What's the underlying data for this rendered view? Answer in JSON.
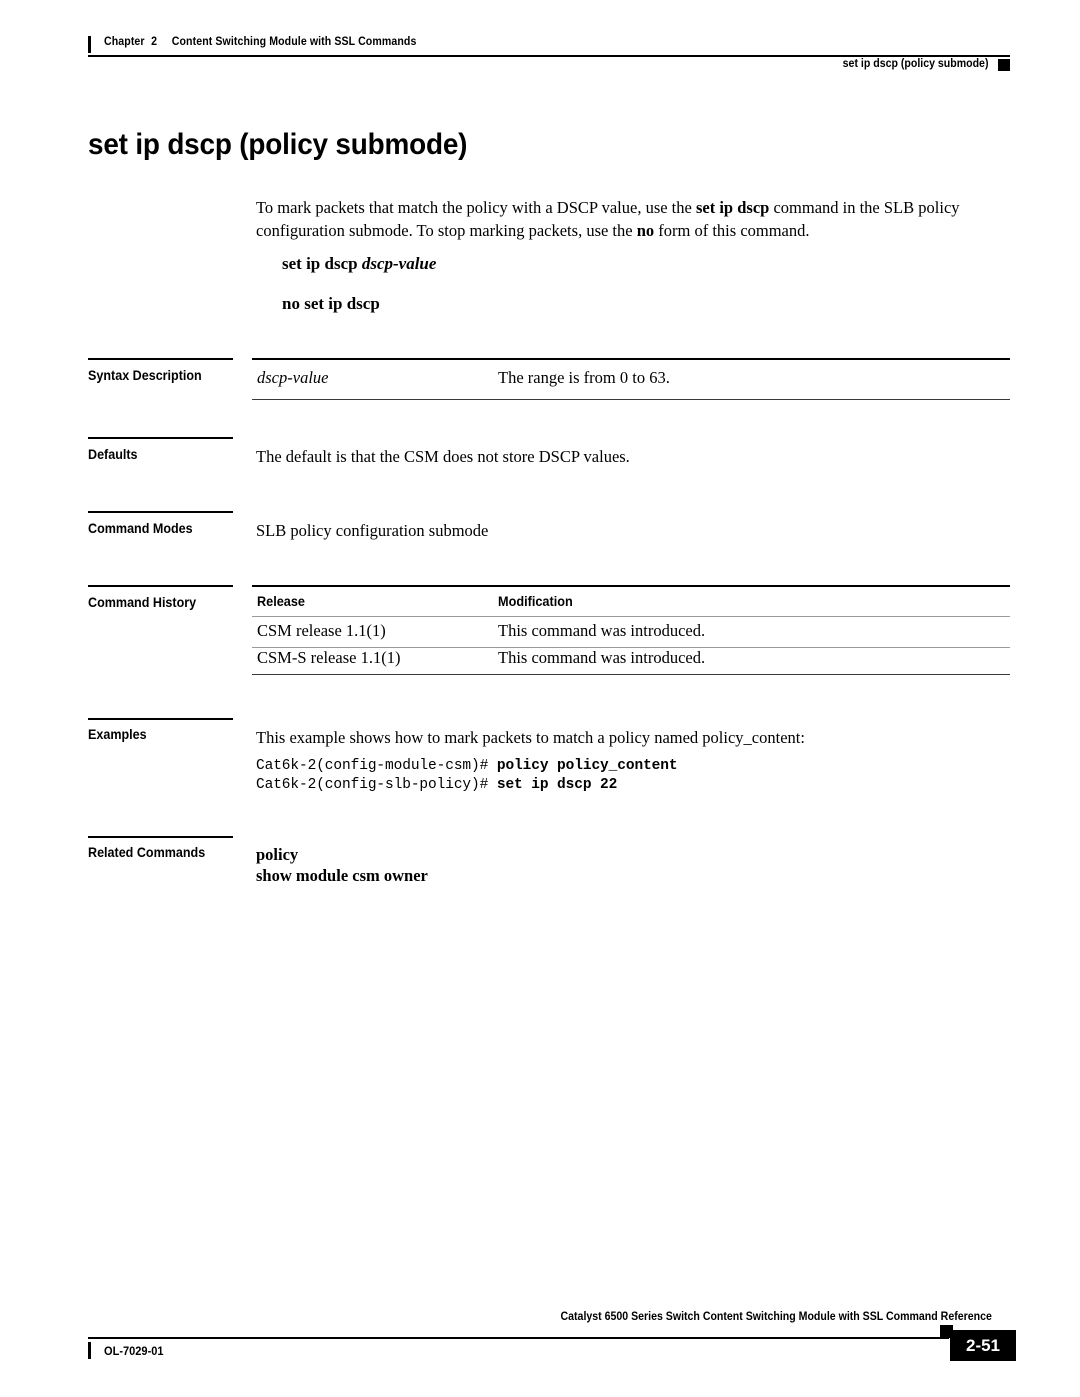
{
  "header": {
    "chapter_label": "Chapter",
    "chapter_number": "2",
    "chapter_title": "Content Switching Module with SSL Commands",
    "running_head": "set ip dscp (policy submode)"
  },
  "title": "set ip dscp (policy submode)",
  "intro": {
    "part1": "To mark packets that match the policy with a DSCP value, use the ",
    "bold1": "set ip dscp",
    "part2": " command in the SLB policy configuration submode. To stop marking packets, use the ",
    "bold2": "no",
    "part3": " form of this command."
  },
  "syntax": {
    "command": "set ip dscp ",
    "argument": "dscp-value",
    "no_form": "no set ip dscp"
  },
  "sections": {
    "syntax_description": {
      "label": "Syntax Description",
      "rows": [
        {
          "term": "dscp-value",
          "description": "The range is from 0 to 63."
        }
      ]
    },
    "defaults": {
      "label": "Defaults",
      "text": "The default is that the CSM does not store DSCP values."
    },
    "command_modes": {
      "label": "Command Modes",
      "text": "SLB policy configuration submode"
    },
    "command_history": {
      "label": "Command History",
      "columns": [
        "Release",
        "Modification"
      ],
      "rows": [
        {
          "release": "CSM release 1.1(1)",
          "modification": "This command was introduced."
        },
        {
          "release": "CSM-S release 1.1(1)",
          "modification": "This command was introduced."
        }
      ]
    },
    "examples": {
      "label": "Examples",
      "intro": "This example shows how to mark packets to match a policy named policy_content:",
      "lines": [
        {
          "prompt": "Cat6k-2(config-module-csm)# ",
          "command": "policy policy_content"
        },
        {
          "prompt": "Cat6k-2(config-slb-policy)# ",
          "command": "set ip dscp 22"
        }
      ]
    },
    "related_commands": {
      "label": "Related Commands",
      "items": [
        "policy",
        "show module csm owner"
      ]
    }
  },
  "footer": {
    "document_title": "Catalyst 6500 Series Switch Content Switching Module with SSL Command Reference",
    "doc_number": "OL-7029-01",
    "page_number": "2-51"
  }
}
